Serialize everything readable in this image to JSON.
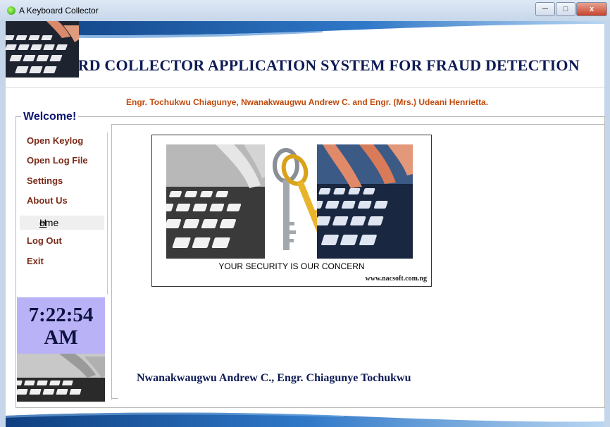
{
  "window": {
    "title": "A Keyboard Collector",
    "minimize_icon": "minimize-icon",
    "maximize_icon": "maximize-icon",
    "close_icon": "close-icon",
    "close_label": "x"
  },
  "header": {
    "app_title": "KEYBOARD COLLECTOR APPLICATION SYSTEM FOR FRAUD DETECTION",
    "authors": "Engr. Tochukwu Chiagunye, Nwanakwaugwu Andrew C. and Engr. (Mrs.) Udeani Henrietta."
  },
  "welcome": {
    "legend": "Welcome!"
  },
  "sidebar": {
    "items": [
      {
        "label": "Open Keylog"
      },
      {
        "label": "Open Log File"
      },
      {
        "label": "Settings"
      },
      {
        "label": "About Us"
      },
      {
        "label": "Home",
        "selected": true
      },
      {
        "label": "Log Out"
      },
      {
        "label": "Exit"
      }
    ],
    "home_first": "H",
    "home_rest": "ome"
  },
  "clock": {
    "time": "7:22:54",
    "ampm": "AM"
  },
  "splash": {
    "caption": "YOUR SECURITY IS OUR CONCERN",
    "url": "www.nacsoft.com.ng"
  },
  "footer": {
    "authors": "Nwanakwaugwu Andrew C., Engr. Chiagunye Tochukwu"
  },
  "colors": {
    "title_navy": "#0e1b55",
    "authors_orange": "#c04a0a",
    "menu_brown": "#7a2a18",
    "clock_bg": "#b9b2f6",
    "banner_blue": "#1c5aa6"
  }
}
